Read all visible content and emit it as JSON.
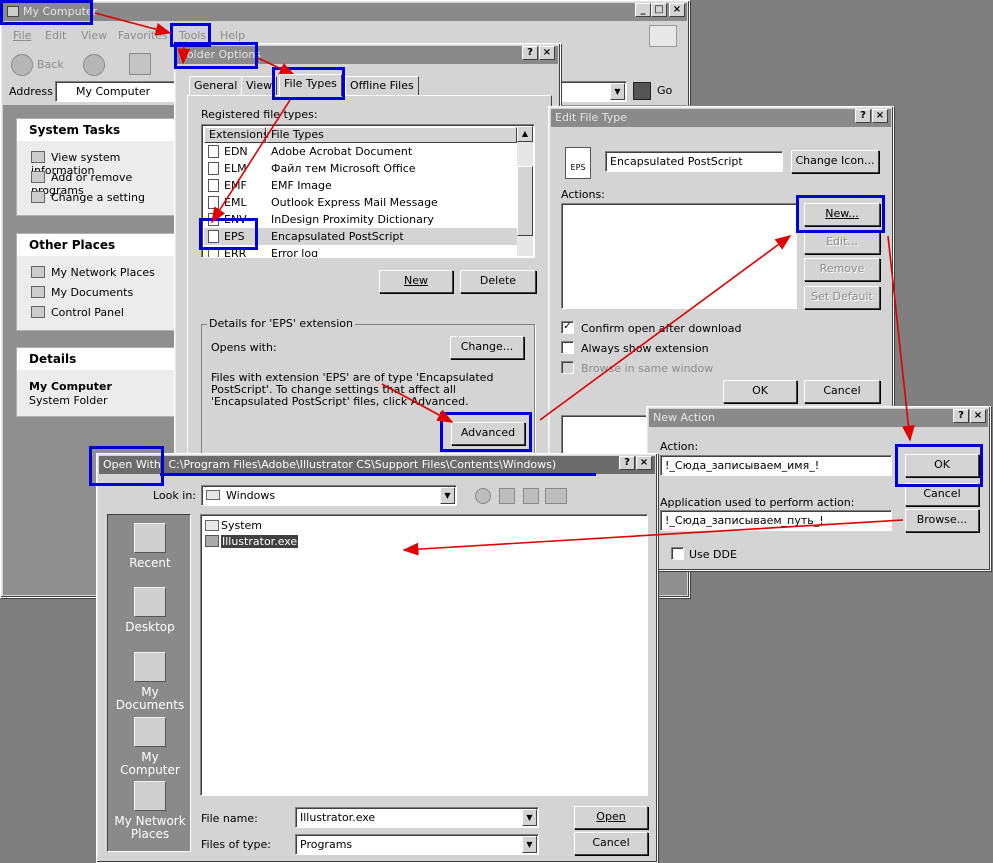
{
  "my_computer": {
    "title": "My Computer",
    "menu": [
      "File",
      "Edit",
      "View",
      "Favorites",
      "Tools",
      "Help"
    ],
    "back_label": "Back",
    "address_label": "Address",
    "address_value": "My Computer",
    "go_label": "Go",
    "system_tasks": {
      "title": "System Tasks",
      "items": [
        "View system information",
        "Add or remove programs",
        "Change a setting"
      ]
    },
    "other_places": {
      "title": "Other Places",
      "items": [
        "My Network Places",
        "My Documents",
        "Control Panel"
      ]
    },
    "details": {
      "title": "Details",
      "name": "My Computer",
      "type": "System Folder"
    }
  },
  "folder_options": {
    "title": "Folder Options",
    "tabs": [
      "General",
      "View",
      "File Types",
      "Offline Files"
    ],
    "registered_label": "Registered file types:",
    "columns": [
      "Extensions",
      "File Types"
    ],
    "rows": [
      {
        "ext": "EDN",
        "type": "Adobe Acrobat Document"
      },
      {
        "ext": "ELM",
        "type": "Файл тем Microsoft Office"
      },
      {
        "ext": "EMF",
        "type": "EMF Image"
      },
      {
        "ext": "EML",
        "type": "Outlook Express Mail Message"
      },
      {
        "ext": "ENV",
        "type": "InDesign Proximity Dictionary"
      },
      {
        "ext": "EPS",
        "type": "Encapsulated PostScript"
      },
      {
        "ext": "ERR",
        "type": "Error log"
      }
    ],
    "new_label": "New",
    "delete_label": "Delete",
    "details_group": "Details for 'EPS' extension",
    "opens_with": "Opens with:",
    "change_label": "Change...",
    "description": "Files with extension 'EPS' are of type 'Encapsulated PostScript'.  To change settings that affect all 'Encapsulated PostScript' files, click Advanced.",
    "advanced_label": "Advanced"
  },
  "edit_file_type": {
    "title": "Edit File Type",
    "icon_text": "EPS",
    "name_value": "Encapsulated PostScript",
    "change_icon_label": "Change Icon...",
    "actions_label": "Actions:",
    "new_label": "New...",
    "edit_label": "Edit...",
    "remove_label": "Remove",
    "set_default_label": "Set Default",
    "confirm_open": "Confirm open after download",
    "always_show": "Always show extension",
    "browse_same": "Browse in same window",
    "ok_label": "OK",
    "cancel_label": "Cancel"
  },
  "new_action": {
    "title": "New Action",
    "action_label": "Action:",
    "action_value": "!_Сюда_записываем_имя_!",
    "ok_label": "OK",
    "cancel_label": "Cancel",
    "app_label": "Application used to perform action:",
    "app_value": "!_Сюда_записываем_путь_!",
    "browse_label": "Browse...",
    "use_dde": "Use DDE"
  },
  "open_with": {
    "title": "Open With",
    "path": "C:\\Program Files\\Adobe\\Illustrator CS\\Support Files\\Contents\\Windows)",
    "look_in_label": "Look in:",
    "look_in_value": "Windows",
    "places": [
      "Recent",
      "Desktop",
      "My Documents",
      "My Computer",
      "My Network Places"
    ],
    "files": [
      "System",
      "Illustrator.exe"
    ],
    "file_name_label": "File name:",
    "file_name_value": "Illustrator.exe",
    "files_of_type_label": "Files of type:",
    "files_of_type_value": "Programs",
    "open_label": "Open",
    "cancel_label": "Cancel"
  },
  "colors": {
    "highlight": "#0000d8",
    "arrow": "#e00000"
  }
}
